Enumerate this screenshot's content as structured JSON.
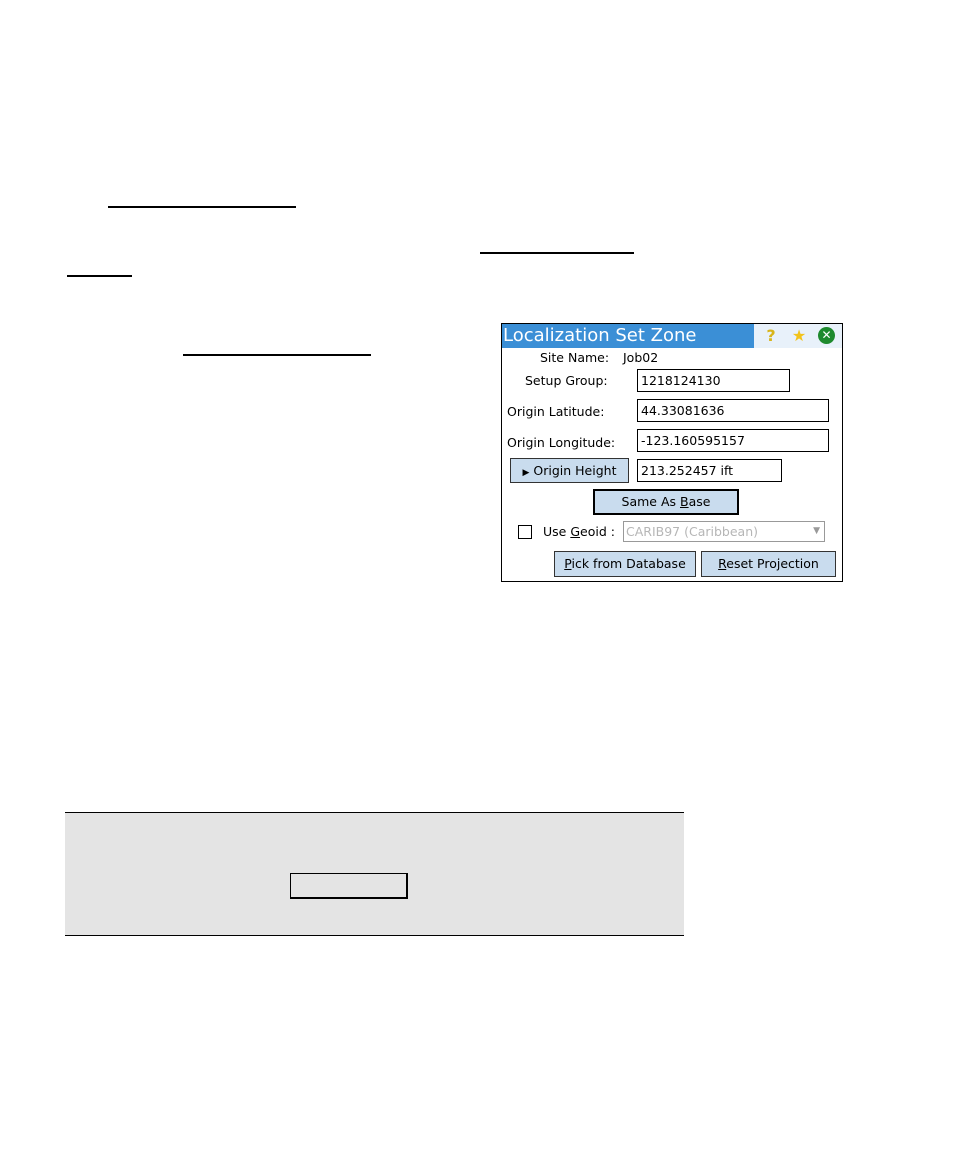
{
  "document": {
    "link_placeholders": [
      {
        "name": "link-line-1"
      },
      {
        "name": "link-line-2"
      },
      {
        "name": "link-line-3"
      },
      {
        "name": "link-line-4"
      }
    ]
  },
  "dialog": {
    "title": "Localization Set Zone",
    "title_icons": {
      "help": "?",
      "favorite": "★",
      "close": "✕"
    },
    "site_name_label": "Site Name:",
    "site_name_value": "Job02",
    "setup_group_label": "Setup Group:",
    "setup_group_value": "1218124130",
    "origin_latitude_label": "Origin Latitude:",
    "origin_latitude_value": "44.33081636",
    "origin_longitude_label": "Origin Longitude:",
    "origin_longitude_value": "-123.160595157",
    "origin_height_button": "Origin Height",
    "origin_height_arrow": "▶",
    "origin_height_value": "213.252457 ift",
    "same_as_base_button_pre": "Same As ",
    "same_as_base_button_u": "B",
    "same_as_base_button_post": "ase",
    "use_geoid_checked": false,
    "use_geoid_label_pre": "Use ",
    "use_geoid_label_u": "G",
    "use_geoid_label_post": "eoid :",
    "geoid_selected": "CARIB97 (Caribbean)",
    "pick_db_u": "P",
    "pick_db_rest": "ick from Database",
    "reset_u": "R",
    "reset_rest": "eset Projection"
  },
  "graybox": {
    "button_label": ""
  }
}
